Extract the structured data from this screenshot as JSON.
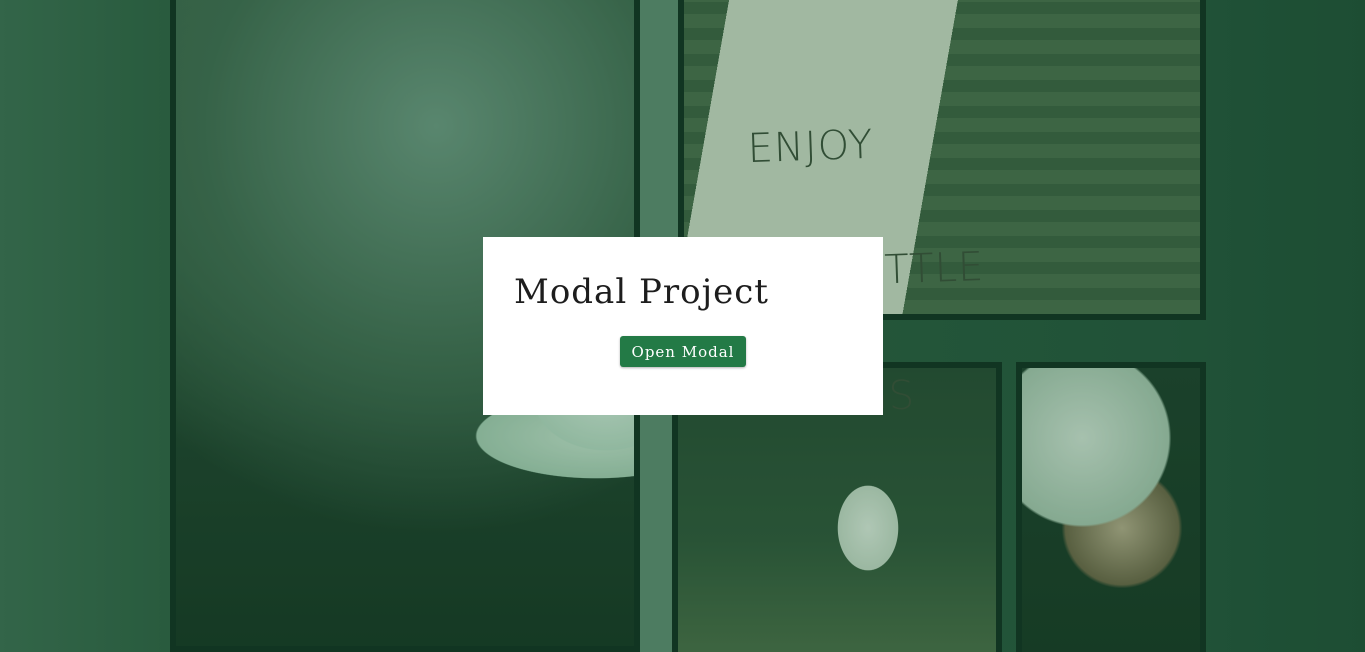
{
  "background": {
    "sign_lines": [
      "ENJOY",
      "THE LITTLE",
      "THINGS"
    ]
  },
  "modal_card": {
    "title": "Modal Project",
    "open_button_label": "Open Modal"
  },
  "colors": {
    "button": "#237a46",
    "overlay_tint": "#185834",
    "card": "#ffffff"
  }
}
